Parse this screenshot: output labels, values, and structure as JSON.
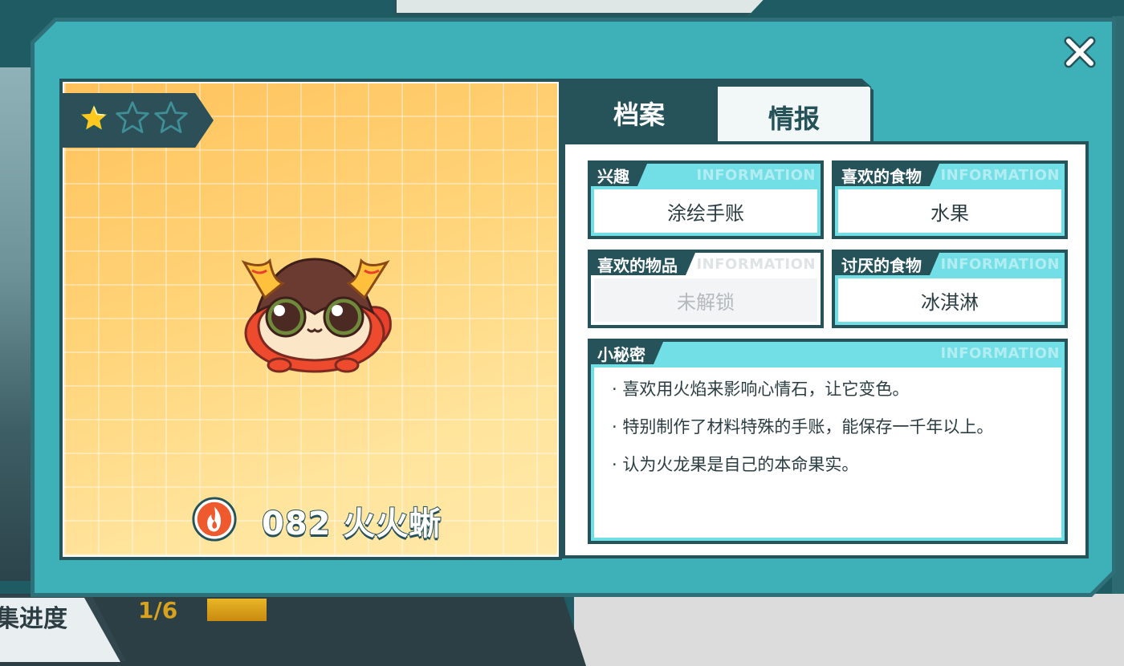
{
  "background": {
    "progress_label": "集进度",
    "progress_count": "1/6",
    "progress_fraction": 0.17
  },
  "creature": {
    "rarity_stars_filled": 1,
    "rarity_stars_total": 3,
    "number_name": "082 火火蜥",
    "element_icon": "fire-icon"
  },
  "tabs": [
    {
      "label": "档案",
      "active": false
    },
    {
      "label": "情报",
      "active": true
    }
  ],
  "info": {
    "watermark": "INFORMATION",
    "interest": {
      "label": "兴趣",
      "value": "涂绘手账"
    },
    "favorite_food": {
      "label": "喜欢的食物",
      "value": "水果"
    },
    "favorite_item": {
      "label": "喜欢的物品",
      "value": "未解锁"
    },
    "disliked_food": {
      "label": "讨厌的食物",
      "value": "冰淇淋"
    },
    "secret": {
      "label": "小秘密",
      "lines": [
        "· 喜欢用火焰来影响心情石，让它变色。",
        "· 特别制作了材料特殊的手账，能保存一千年以上。",
        "· 认为火龙果是自己的本命果实。"
      ]
    }
  },
  "colors": {
    "frame_dark": "#26525a",
    "modal_teal": "#3eb0b8",
    "card_header_cyan": "#72dfe6",
    "star_gold": "#ffc81e"
  }
}
